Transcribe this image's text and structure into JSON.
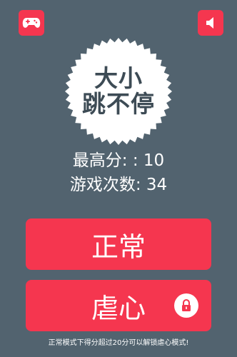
{
  "game": {
    "title_line1": "大小",
    "title_line2": "跳不停"
  },
  "toolbar": {
    "games_icon": "gamepad-icon",
    "sound_icon": "speaker-icon"
  },
  "stats": {
    "best_score_text": "最高分: : 10",
    "games_played_text": "游戏次数: 34"
  },
  "modes": {
    "normal_label": "正常",
    "hard_label": "虐心",
    "hard_locked_icon": "lock-icon"
  },
  "hint": "正常模式下得分超过20分可以解锁虐心模式!",
  "colors": {
    "background": "#52636f",
    "accent": "#f5364f",
    "badge": "#ffffff",
    "title_text": "#3d4b55"
  }
}
